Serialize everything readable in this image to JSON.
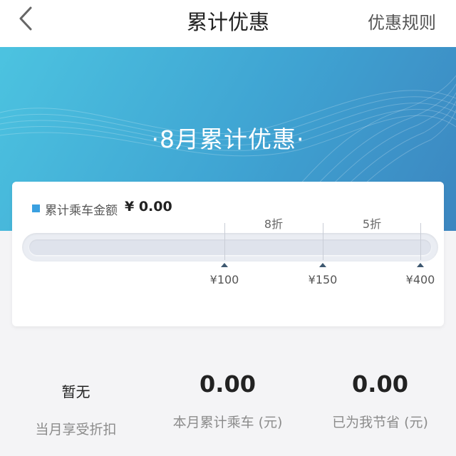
{
  "nav": {
    "title": "累计优惠",
    "rules_label": "优惠规则"
  },
  "hero": {
    "title": "·8月累计优惠·"
  },
  "card": {
    "legend_label": "累计乘车金额",
    "amount": "¥ 0.00",
    "progress_fraction": 0,
    "tiers": [
      {
        "label": "8折"
      },
      {
        "label": "5折"
      }
    ],
    "thresholds": [
      {
        "label": "¥100"
      },
      {
        "label": "¥150"
      },
      {
        "label": "¥400"
      }
    ]
  },
  "stats": [
    {
      "value": "暂无",
      "label": "当月享受折扣"
    },
    {
      "value": "0.00",
      "label": "本月累计乘车 (元)"
    },
    {
      "value": "0.00",
      "label": "已为我节省 (元)"
    }
  ],
  "colors": {
    "accent": "#3aa0e0",
    "hero_start": "#4cc3e0",
    "hero_end": "#3c86c0"
  }
}
